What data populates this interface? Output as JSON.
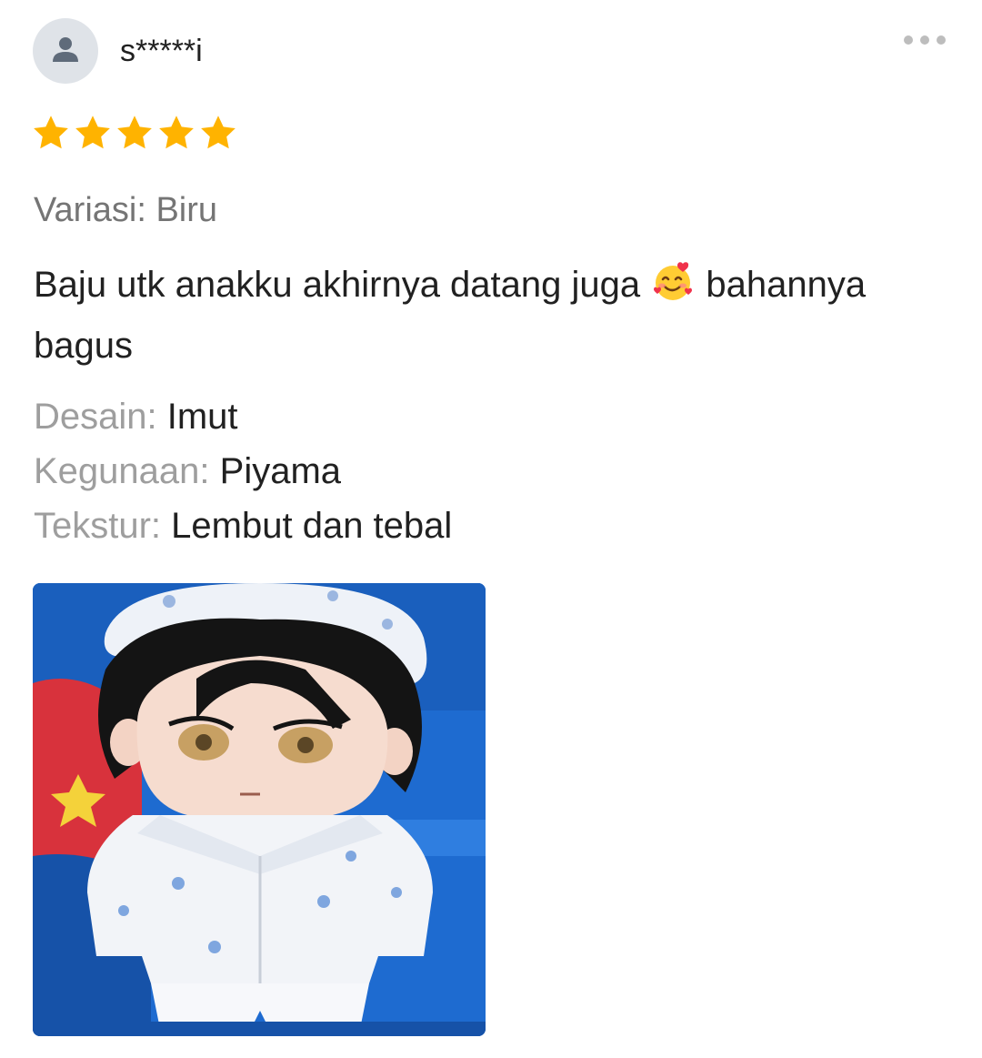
{
  "review": {
    "user": {
      "username": "s*****i",
      "avatar_icon": "person-icon"
    },
    "menu_icon": "more-horizontal-icon",
    "rating": 5,
    "rating_max": 5,
    "star_color": "#ffb300",
    "variation_label": "Variasi: Biru",
    "text_before_emoji": "Baju utk anakku akhirnya datang juga ",
    "emoji": "smiling-face-with-hearts",
    "text_after_emoji": " bahannya bagus",
    "attributes": [
      {
        "key": "Desain:",
        "value": "Imut"
      },
      {
        "key": "Kegunaan:",
        "value": "Piyama"
      },
      {
        "key": "Tekstur:",
        "value": "Lembut dan tebal"
      }
    ],
    "photo_subject": "plush doll wearing white pajamas with blue flowers"
  }
}
